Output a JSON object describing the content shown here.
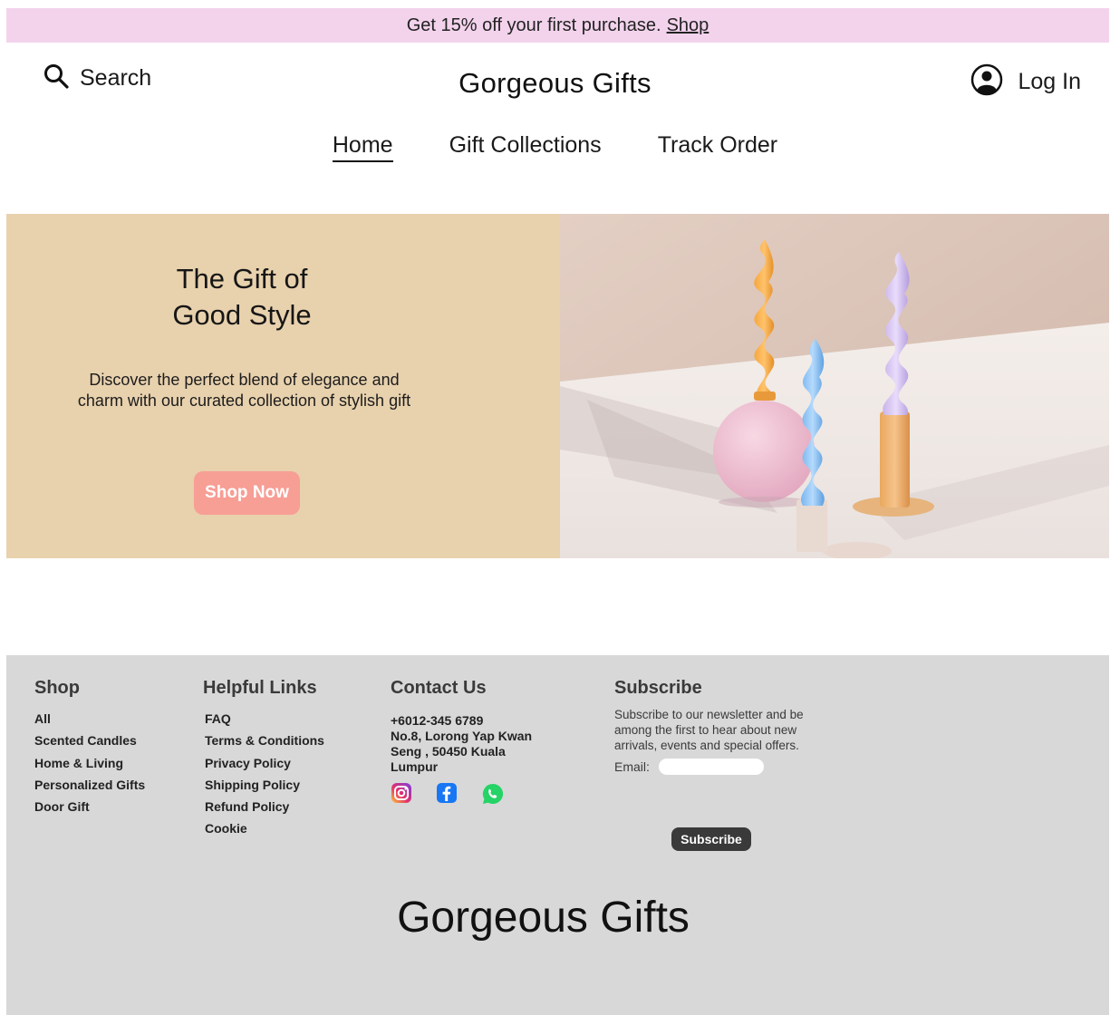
{
  "announcement": {
    "text": "Get 15% off your first purchase.",
    "link": "Shop"
  },
  "header": {
    "search_label": "Search",
    "brand": "Gorgeous Gifts",
    "login_label": "Log In"
  },
  "nav": {
    "items": [
      "Home",
      "Gift Collections",
      "Track Order"
    ],
    "active": "Home"
  },
  "hero": {
    "title_line1": "The Gift of",
    "title_line2": "Good Style",
    "description": "Discover the perfect blend of elegance and charm with our curated collection of stylish gift",
    "cta": "Shop Now"
  },
  "footer": {
    "shop": {
      "title": "Shop",
      "items": [
        "All",
        "Scented Candles",
        "Home & Living",
        "Personalized Gifts",
        "Door Gift"
      ]
    },
    "helpful": {
      "title": "Helpful Links",
      "items": [
        "FAQ",
        "Terms & Conditions",
        "Privacy Policy",
        "Shipping Policy",
        "Refund Policy",
        "Cookie"
      ]
    },
    "contact": {
      "title": "Contact Us",
      "phone": "+6012-345 6789",
      "address": "No.8, Lorong Yap Kwan Seng , 50450 Kuala Lumpur"
    },
    "subscribe": {
      "title": "Subscribe",
      "text": "Subscribe to our newsletter and be among the first to hear about new arrivals, events and special offers.",
      "email_label": "Email:",
      "email_placeholder": "",
      "button": "Subscribe"
    },
    "brand": "Gorgeous Gifts"
  },
  "colors": {
    "announcement_bg": "#f3d3ec",
    "hero_left_bg": "#e8d1ad",
    "cta_bg": "#f79e95",
    "footer_bg": "#d8d8d8",
    "subscribe_button_bg": "#3a3a3a"
  },
  "icons": [
    "search-icon",
    "user-circle-icon",
    "instagram-icon",
    "facebook-icon",
    "whatsapp-icon"
  ]
}
